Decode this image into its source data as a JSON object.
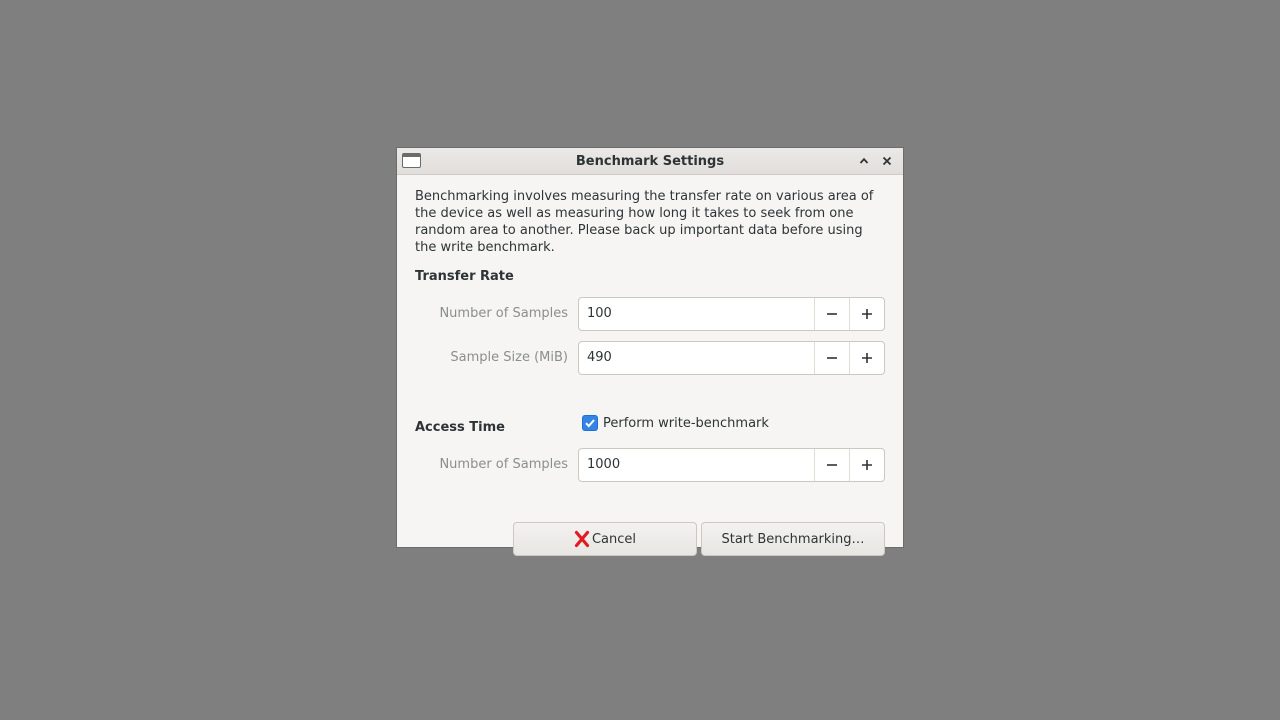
{
  "window": {
    "title": "Benchmark Settings"
  },
  "description": "Benchmarking involves measuring the transfer rate on various area of the device as well as measuring how long it takes to seek from one random area to another. Please back up important data before using the write benchmark.",
  "transfer_rate": {
    "heading": "Transfer Rate",
    "num_samples_label": "Number of Samples",
    "num_samples_value": "100",
    "sample_size_label": "Sample Size (MiB)",
    "sample_size_value": "490",
    "write_benchmark_label": "Perform write-benchmark",
    "write_benchmark_checked": true
  },
  "access_time": {
    "heading": "Access Time",
    "num_samples_label": "Number of Samples",
    "num_samples_value": "1000"
  },
  "buttons": {
    "cancel_label": "Cancel",
    "start_label": "Start Benchmarking…"
  },
  "icons": {
    "window": "window-icon",
    "collapse": "chevron-up-icon",
    "close": "close-icon",
    "decrement": "minus-icon",
    "increment": "plus-icon",
    "check": "check-icon",
    "cancel": "red-x-icon"
  },
  "colors": {
    "desktop": "#7f7f7f",
    "dialog_bg": "#f6f5f4",
    "accent": "#3584e4",
    "cancel_icon": "#e01b24"
  }
}
